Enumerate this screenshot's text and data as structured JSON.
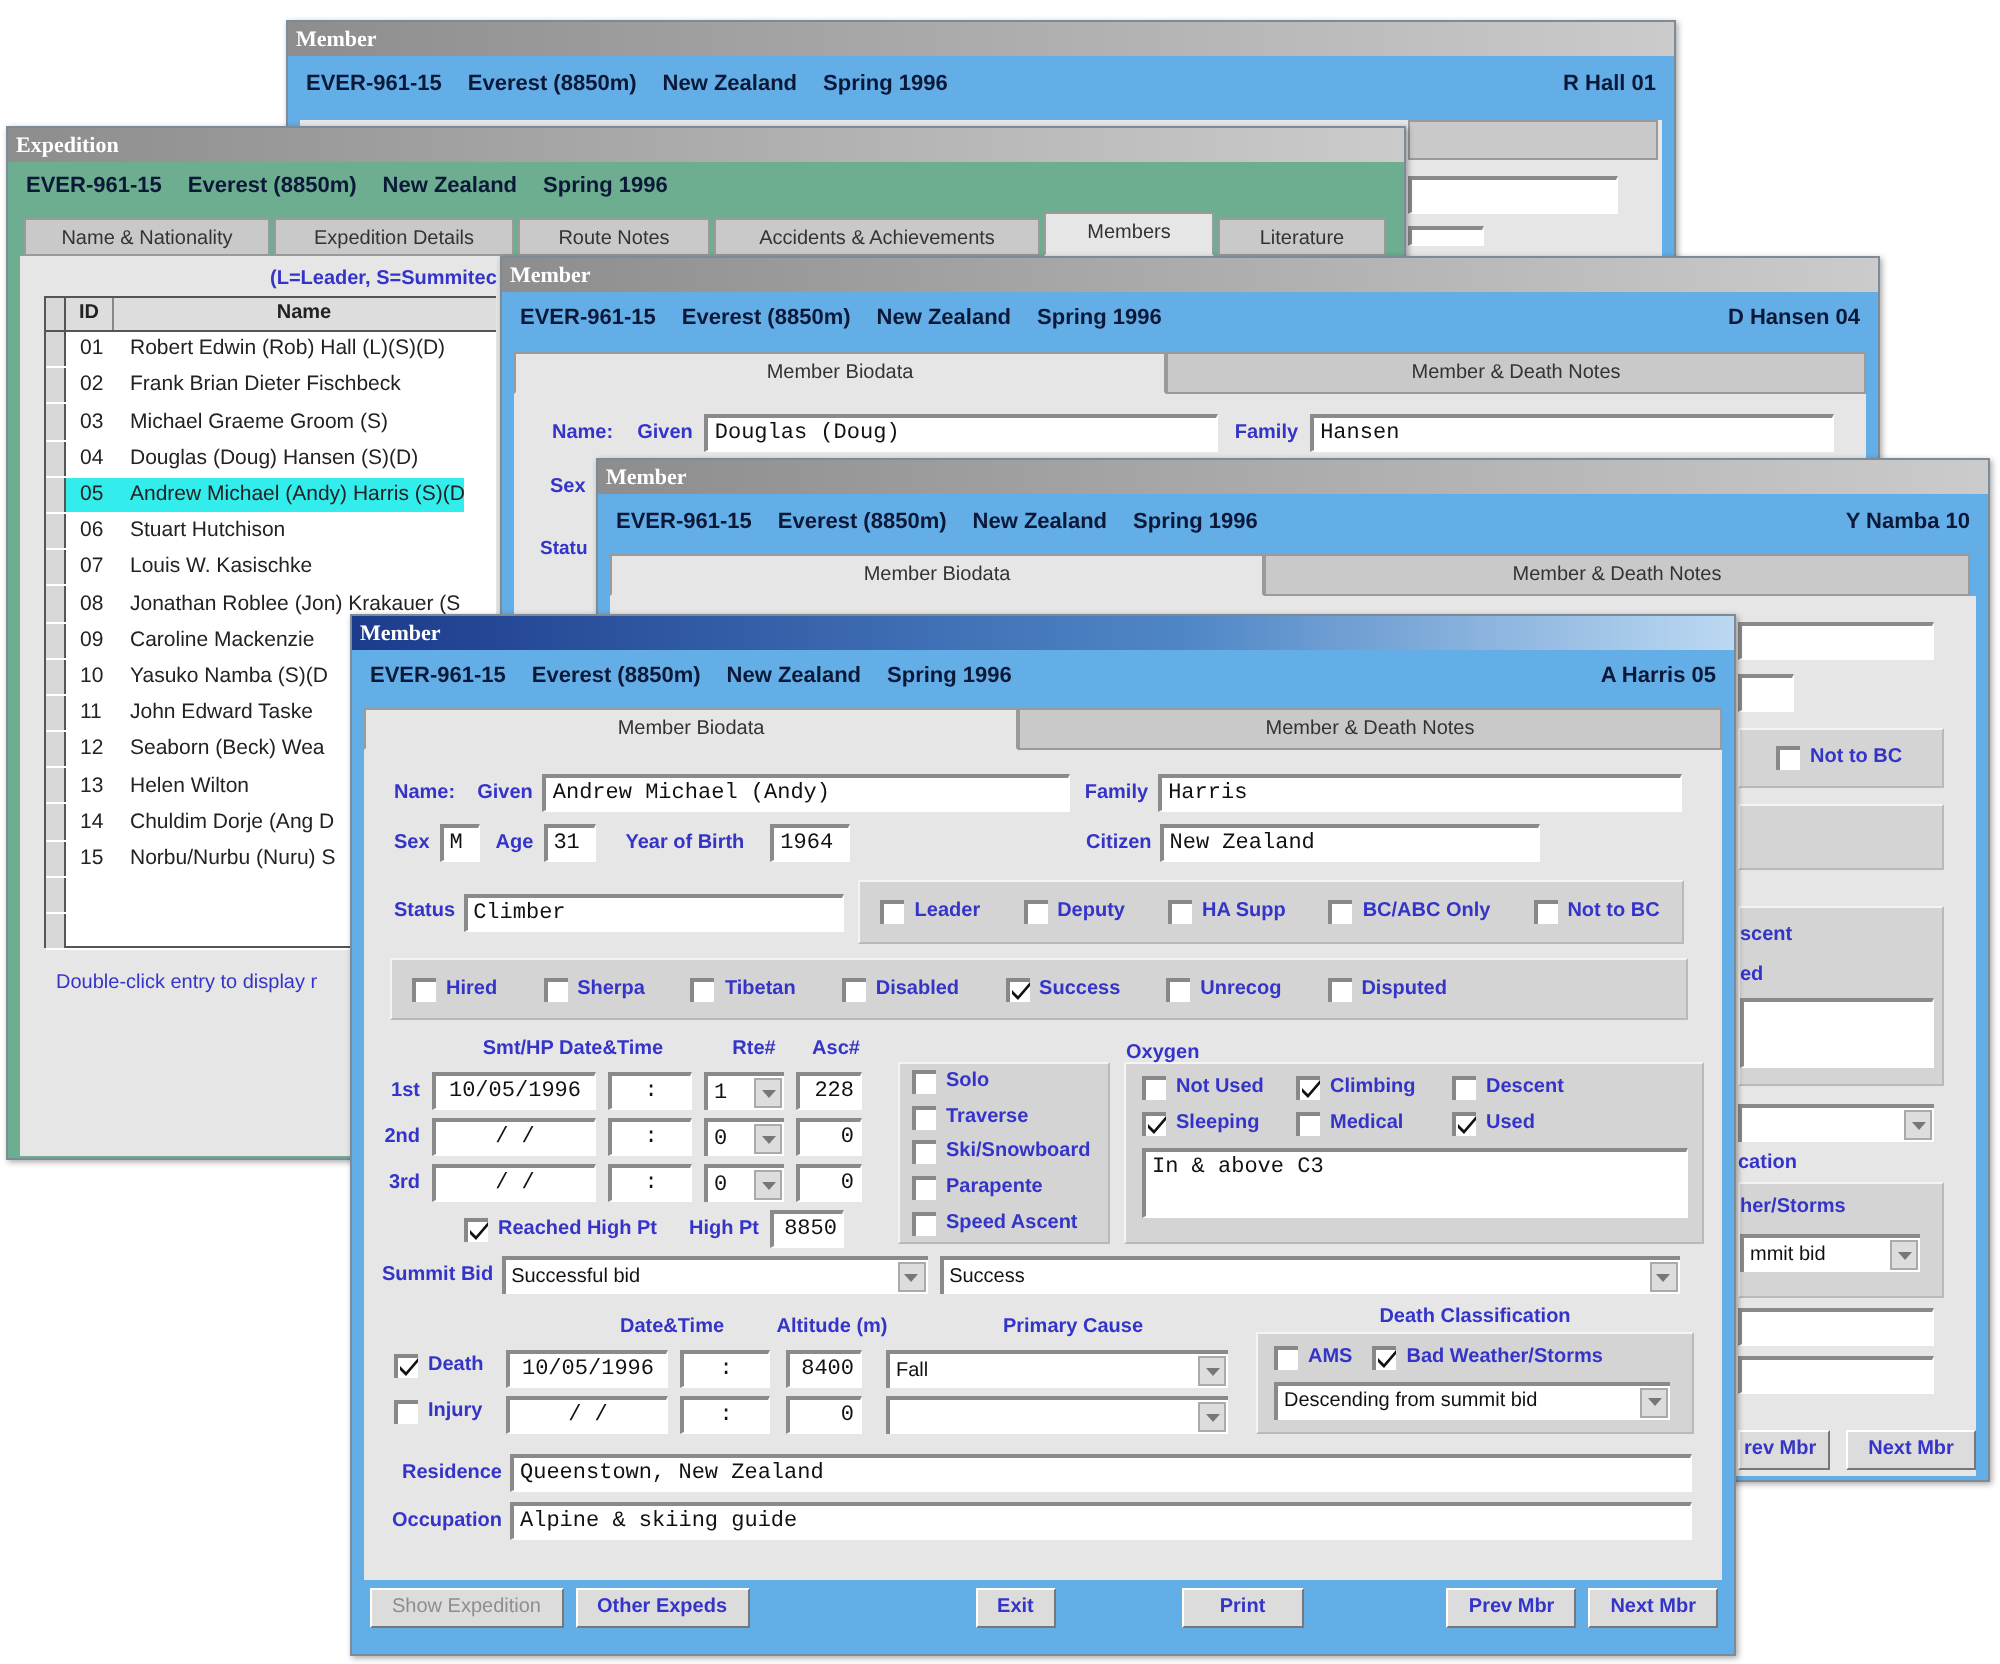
{
  "rhall_window": {
    "title": "Member",
    "header": [
      "EVER-961-15",
      "Everest (8850m)",
      "New Zealand",
      "Spring 1996"
    ],
    "member": "R Hall  01"
  },
  "expedition_window": {
    "title": "Expedition",
    "header": [
      "EVER-961-15",
      "Everest (8850m)",
      "New Zealand",
      "Spring 1996"
    ],
    "tabs": [
      {
        "label": "Name & Nationality",
        "selected": false
      },
      {
        "label": "Expedition Details",
        "selected": false
      },
      {
        "label": "Route Notes",
        "selected": false
      },
      {
        "label": "Accidents & Achievements",
        "selected": false
      },
      {
        "label": "Members",
        "selected": true
      },
      {
        "label": "Literature",
        "selected": false
      }
    ],
    "legend": "(L=Leader, S=Summitec",
    "columns": [
      "ID",
      "Name"
    ],
    "rows": [
      {
        "id": "01",
        "name": "Robert Edwin (Rob) Hall (L)(S)(D)",
        "selected": false
      },
      {
        "id": "02",
        "name": "Frank Brian Dieter Fischbeck",
        "selected": false
      },
      {
        "id": "03",
        "name": "Michael Graeme Groom (S)",
        "selected": false
      },
      {
        "id": "04",
        "name": "Douglas (Doug) Hansen (S)(D)",
        "selected": false
      },
      {
        "id": "05",
        "name": "Andrew Michael (Andy) Harris (S)(D",
        "selected": true
      },
      {
        "id": "06",
        "name": "Stuart Hutchison",
        "selected": false
      },
      {
        "id": "07",
        "name": "Louis W. Kasischke",
        "selected": false
      },
      {
        "id": "08",
        "name": "Jonathan Roblee (Jon) Krakauer (S",
        "selected": false
      },
      {
        "id": "09",
        "name": "Caroline Mackenzie",
        "selected": false
      },
      {
        "id": "10",
        "name": "Yasuko Namba (S)(D",
        "selected": false
      },
      {
        "id": "11",
        "name": "John Edward Taske",
        "selected": false
      },
      {
        "id": "12",
        "name": "Seaborn (Beck) Wea",
        "selected": false
      },
      {
        "id": "13",
        "name": "Helen Wilton",
        "selected": false
      },
      {
        "id": "14",
        "name": "Chuldim Dorje (Ang D",
        "selected": false
      },
      {
        "id": "15",
        "name": "Norbu/Nurbu (Nuru) S",
        "selected": false
      }
    ],
    "hint": "Double-click entry to display r"
  },
  "hansen_window": {
    "title": "Member",
    "header": [
      "EVER-961-15",
      "Everest (8850m)",
      "New Zealand",
      "Spring 1996"
    ],
    "member": "D Hansen  04",
    "tabs": [
      {
        "label": "Member Biodata",
        "selected": true
      },
      {
        "label": "Member & Death Notes",
        "selected": false
      }
    ],
    "name_label": "Name:",
    "given_label": "Given",
    "given": "Douglas (Doug)",
    "family_label": "Family",
    "family": "Hansen",
    "sex_label": "Sex",
    "status_label": "Statu"
  },
  "namba_window": {
    "title": "Member",
    "header": [
      "EVER-961-15",
      "Everest (8850m)",
      "New Zealand",
      "Spring 1996"
    ],
    "member": "Y Namba  10",
    "tabs": [
      {
        "label": "Member Biodata",
        "selected": true
      },
      {
        "label": "Member & Death Notes",
        "selected": false
      }
    ],
    "not_to_bc": {
      "label": "Not to BC",
      "checked": false
    },
    "descent_label": "scent",
    "used_label": "ed",
    "classification_label": "cation",
    "storms_label": "her/Storms",
    "death_cause": "mmit bid",
    "buttons": [
      "rev Mbr",
      "Next Mbr"
    ]
  },
  "member_window": {
    "title": "Member",
    "header": [
      "EVER-961-15",
      "Everest (8850m)",
      "New Zealand",
      "Spring 1996"
    ],
    "member": "A Harris  05",
    "tabs": [
      {
        "label": "Member Biodata",
        "selected": true
      },
      {
        "label": "Member & Death Notes",
        "selected": false
      }
    ],
    "name": {
      "label": "Name:",
      "given_label": "Given",
      "given": "Andrew Michael (Andy)",
      "family_label": "Family",
      "family": "Harris"
    },
    "sex": {
      "label": "Sex",
      "value": "M"
    },
    "age": {
      "label": "Age",
      "value": "31"
    },
    "birth_year": {
      "label": "Year of Birth",
      "value": "1964"
    },
    "citizen": {
      "label": "Citizen",
      "value": "New Zealand"
    },
    "status": {
      "label": "Status",
      "value": "Climber"
    },
    "roles": [
      {
        "label": "Leader",
        "checked": false
      },
      {
        "label": "Deputy",
        "checked": false
      },
      {
        "label": "HA Supp",
        "checked": false
      },
      {
        "label": "BC/ABC Only",
        "checked": false
      },
      {
        "label": "Not to BC",
        "checked": false
      }
    ],
    "flags": [
      {
        "label": "Hired",
        "checked": false
      },
      {
        "label": "Sherpa",
        "checked": false
      },
      {
        "label": "Tibetan",
        "checked": false
      },
      {
        "label": "Disabled",
        "checked": false
      },
      {
        "label": "Success",
        "checked": true
      },
      {
        "label": "Unrecog",
        "checked": false
      },
      {
        "label": "Disputed",
        "checked": false
      }
    ],
    "ascent_headers": {
      "date": "Smt/HP Date&Time",
      "route": "Rte#",
      "ascent": "Asc#"
    },
    "ascents": [
      {
        "label": "1st",
        "date": "10/05/1996",
        "time": ":",
        "route": "1",
        "ascent": "228"
      },
      {
        "label": "2nd",
        "date": "/  /",
        "time": ":",
        "route": "0",
        "ascent": "0"
      },
      {
        "label": "3rd",
        "date": "/  /",
        "time": ":",
        "route": "0",
        "ascent": "0"
      }
    ],
    "reached_high_point": {
      "label": "Reached High Pt",
      "checked": true
    },
    "high_point": {
      "label": "High Pt",
      "value": "8850"
    },
    "ascent_types": [
      {
        "label": "Solo",
        "checked": false
      },
      {
        "label": "Traverse",
        "checked": false
      },
      {
        "label": "Ski/Snowboard",
        "checked": false
      },
      {
        "label": "Parapente",
        "checked": false
      },
      {
        "label": "Speed Ascent",
        "checked": false
      }
    ],
    "oxygen": {
      "label": "Oxygen",
      "options": [
        {
          "label": "Not Used",
          "checked": false
        },
        {
          "label": "Climbing",
          "checked": true
        },
        {
          "label": "Descent",
          "checked": false
        },
        {
          "label": "Sleeping",
          "checked": true
        },
        {
          "label": "Medical",
          "checked": false
        },
        {
          "label": "Used",
          "checked": true
        }
      ],
      "note": "In & above C3"
    },
    "summit_bid": {
      "label": "Summit Bid",
      "value": "Successful bid",
      "result": "Success"
    },
    "incident_headers": {
      "date": "Date&Time",
      "altitude": "Altitude (m)",
      "cause": "Primary Cause"
    },
    "incidents": [
      {
        "label": "Death",
        "checked": true,
        "date": "10/05/1996",
        "time": ":",
        "altitude": "8400",
        "cause": "Fall"
      },
      {
        "label": "Injury",
        "checked": false,
        "date": "/  /",
        "time": ":",
        "altitude": "0"
      }
    ],
    "death_classification": {
      "label": "Death Classification",
      "options": [
        {
          "label": "AMS",
          "checked": false
        },
        {
          "label": "Bad Weather/Storms",
          "checked": true
        }
      ],
      "value": "Descending from summit bid"
    },
    "residence": {
      "label": "Residence",
      "value": "Queenstown, New Zealand"
    },
    "occupation": {
      "label": "Occupation",
      "value": "Alpine & skiing guide"
    },
    "buttons": [
      {
        "label": "Show Expedition",
        "disabled": true
      },
      {
        "label": "Other Expeds",
        "disabled": false
      },
      {
        "label": "Exit",
        "disabled": false
      },
      {
        "label": "Print",
        "disabled": false
      },
      {
        "label": "Prev Mbr",
        "disabled": false
      },
      {
        "label": "Next Mbr",
        "disabled": false
      }
    ]
  }
}
